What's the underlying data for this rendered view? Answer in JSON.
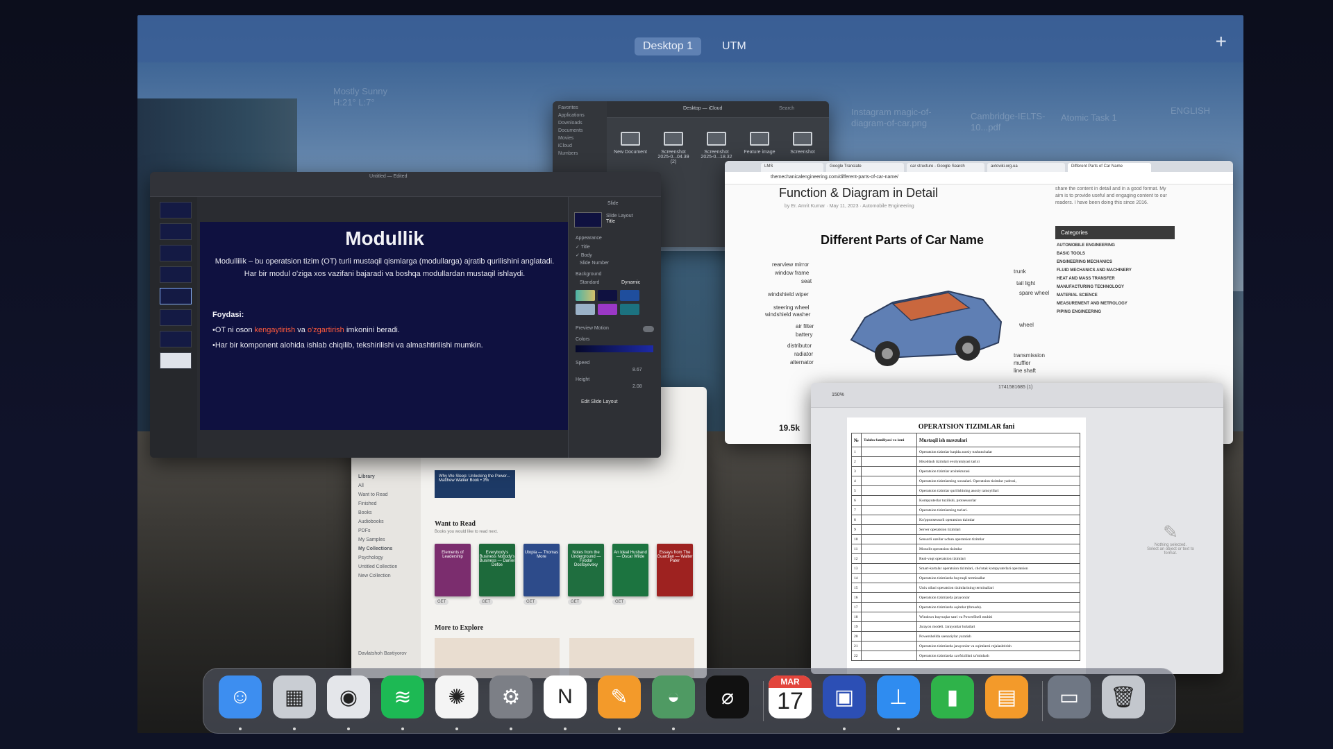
{
  "spaces": {
    "tabs": [
      {
        "label": "Desktop 1"
      },
      {
        "label": "UTM"
      }
    ],
    "add_label": "+"
  },
  "desktop": {
    "weather_city": "Mostly Sunny",
    "weather_temp": "H:21° L:7°",
    "ghost_files": [
      "Instagram magic-of-diagram-of-car.png",
      "Cambridge-IELTS-10...pdf",
      "Atomic Task 1",
      "ENGLISH"
    ]
  },
  "finder": {
    "sidebar": [
      "Favorites",
      "Applications",
      "Downloads",
      "Documents",
      "Movies",
      "iCloud",
      "Numbers"
    ],
    "location": "Desktop — iCloud",
    "search_placeholder": "Search",
    "files": [
      "New Document",
      "Screenshot 2025-0...04.39 (2)",
      "Screenshot 2025-0...18.32",
      "Feature image",
      "Screenshot"
    ]
  },
  "keynote": {
    "window_title": "Untitled — Edited",
    "slide": {
      "title": "Modullik",
      "body": "Modullilik – bu operatsion tizim (OT) turli mustaqil qismlarga (modullarga) ajratib qurilishini anglatadi. Har bir modul o'ziga xos vazifani bajaradi va boshqa modullardan mustaqil ishlaydi.",
      "benefits_heading": "Foydasi:",
      "bullet1_pre": "•OT ni oson ",
      "bullet1_hl1": "kengaytirish",
      "bullet1_mid": " va ",
      "bullet1_hl2": "o'zgartirish",
      "bullet1_post": " imkonini beradi.",
      "bullet2": "•Har bir komponent alohida ishlab chiqilib, tekshirilishi va almashtirilishi mumkin."
    },
    "inspector": {
      "tab": "Slide",
      "layout_label": "Slide Layout",
      "layout_value": "Title",
      "appearance": "Appearance",
      "opt_title": "Title",
      "opt_body": "Body",
      "opt_slide_number": "Slide Number",
      "background": "Background",
      "bg_standard": "Standard",
      "bg_dynamic": "Dynamic",
      "preview_motion": "Preview Motion",
      "colors": "Colors",
      "speed": "Speed",
      "speed_value": "8.67",
      "height": "Height",
      "height_value": "2.08",
      "edit_layout": "Edit Slide Layout"
    },
    "colors": {
      "slide_bg": "#0f1140",
      "highlight": "#ff5a3c"
    }
  },
  "books": {
    "sidebar": [
      "Library",
      "All",
      "Want to Read",
      "Finished",
      "Books",
      "Audiobooks",
      "PDFs",
      "My Samples",
      "My Collections",
      "Psychology",
      "Untitled Collection",
      "New Collection"
    ],
    "user": "Davlatshoh Baxtiyorov",
    "current_book": "Why We Sleep: Unlocking the Power... Matthew Walker Book • 3%",
    "want_to_read": "Want to Read",
    "want_to_read_sub": "Books you would like to read next.",
    "shelf": [
      {
        "title": "Elements of Leadership",
        "color": "#7b2d6e"
      },
      {
        "title": "Everybody's Business Nobody's Business — Daniel Defoe",
        "color": "#1d6a3b"
      },
      {
        "title": "Utopia — Thomas More",
        "color": "#2d4b8a"
      },
      {
        "title": "Notes from the Underground — Fyodor Dostoyevsky",
        "color": "#1f6e3f"
      },
      {
        "title": "An Ideal Husband — Oscar Wilde",
        "color": "#1c7440"
      },
      {
        "title": "Essays from The Guardian — Walter Pater",
        "color": "#9e2220"
      }
    ],
    "get_label": "GET",
    "more_to_explore": "More to Explore"
  },
  "chrome": {
    "tabs": [
      "LMS",
      "Google Translate",
      "car structure - Google Search",
      "avtoviki.org.ua",
      "Different Parts of Car Name"
    ],
    "url": "themechanicalengineering.com/different-parts-of-car-name/",
    "heading": "Function & Diagram in Detail",
    "author": "by Er. Amrit Kumar  ·  May 11, 2023  ·  Automobile Engineering",
    "side_text": "share the content in detail and in a good format. My aim is to provide useful and engaging content to our readers. I have been doing this since 2016.",
    "diagram_title": "Different Parts of Car Name",
    "left_labels": [
      "rearview mirror",
      "window frame",
      "seat",
      "windshield wiper",
      "steering wheel",
      "windshield washer",
      "air filter",
      "battery",
      "distributor",
      "radiator",
      "alternator"
    ],
    "right_labels": [
      "trunk",
      "tail light",
      "spare wheel",
      "wheel",
      "transmission",
      "muffler",
      "line shaft"
    ],
    "views": "19.5k",
    "categories_title": "Categories",
    "categories": [
      "AUTOMOBILE ENGINEERING",
      "BASIC TOOLS",
      "ENGINEERING MECHANICS",
      "FLUID MECHANICS AND MACHINERY",
      "HEAT AND MASS TRANSFER",
      "MANUFACTURING TECHNOLOGY",
      "MATERIAL SCIENCE",
      "MEASUREMENT AND METROLOGY",
      "PIPING ENGINEERING"
    ]
  },
  "pages": {
    "window_title": "1741581685 (1)",
    "zoom": "150%",
    "doc_title": "OPERATSION TIZIMLAR fani",
    "col_num": "№",
    "col_name": "Talaba familiyasi va ismi",
    "col_topic": "Mustaqil ish mavzulari",
    "rows": [
      {
        "n": "1",
        "t": "Operatsion tizimlar haqida asosiy tushunchalar"
      },
      {
        "n": "2",
        "t": "Hisoblash tizimlari evolyutsiyasi tarixi"
      },
      {
        "n": "3",
        "t": "Operatsion tizimlar arxitekturasi"
      },
      {
        "n": "4",
        "t": "Operatsion tizimlarning xossalari. Operatsion tizimlar yadrosi,"
      },
      {
        "n": "5",
        "t": "Operatsion tizimlar qurilishining asosiy tamoyillari"
      },
      {
        "n": "6",
        "t": "Kompyuterlar tuzilishi, protsessorlar"
      },
      {
        "n": "7",
        "t": "Operatsion tizimlarning turlari."
      },
      {
        "n": "8",
        "t": "Ko'pprotsessorli operatsion tizimlar"
      },
      {
        "n": "9",
        "t": "Server operatsion tizimlari"
      },
      {
        "n": "10",
        "t": "Sensorli uzellar uchun operatsion tizimlar"
      },
      {
        "n": "11",
        "t": "Monolit operatsion tizimlar"
      },
      {
        "n": "12",
        "t": "Real-vaqt operatsion tizimlari"
      },
      {
        "n": "13",
        "t": "Smart-kartalar operatsion tizimlari, cho'ntak kompyuterlari operatsion"
      },
      {
        "n": "14",
        "t": "Operatsion tizimlarda buyruqli terminallar"
      },
      {
        "n": "15",
        "t": "Unix oilasi operatsion tizimlarining terminallari"
      },
      {
        "n": "16",
        "t": "Operatsion tizimlarda jarayonlar"
      },
      {
        "n": "17",
        "t": "Operatsion tizimlarda oqimlar (threads)."
      },
      {
        "n": "18",
        "t": "Windows buyruqlar satri va PowerShell muhiti"
      },
      {
        "n": "19",
        "t": "Jarayon modeli. Jarayonlar holatlari"
      },
      {
        "n": "20",
        "t": "Powershellda ssenariylar yaratish"
      },
      {
        "n": "21",
        "t": "Operatsion tizimlarda jarayonlar va oqimlarni rejalashtirish"
      },
      {
        "n": "22",
        "t": "Operatsion tizimlarda xavfsizlikni ta'minlash"
      }
    ],
    "nothing_selected": "Nothing selected.",
    "select_hint": "Select an object or text to format."
  },
  "dock": {
    "calendar_month": "MAR",
    "calendar_day": "17",
    "apps": [
      {
        "name": "Finder",
        "color": "#3d8ef0",
        "glyph": "☺"
      },
      {
        "name": "Launchpad",
        "color": "#c9cdd3",
        "glyph": "▦"
      },
      {
        "name": "Chrome",
        "color": "#e4e6ea",
        "glyph": "◉"
      },
      {
        "name": "Spotify",
        "color": "#1db954",
        "glyph": "≋"
      },
      {
        "name": "ChatGPT",
        "color": "#f4f4f4",
        "glyph": "✺"
      },
      {
        "name": "System Settings",
        "color": "#7c7f86",
        "glyph": "⚙"
      },
      {
        "name": "Notion",
        "color": "#ffffff",
        "glyph": "N"
      },
      {
        "name": "Pages",
        "color": "#f39a2a",
        "glyph": "✎"
      },
      {
        "name": "Maps",
        "color": "#4f9a63",
        "glyph": "◒"
      },
      {
        "name": "Perplexity",
        "color": "#111111",
        "glyph": "⌀"
      },
      {
        "name": "Calendar",
        "color": "#ffffff",
        "glyph": ""
      },
      {
        "name": "Screens",
        "color": "#2c4fb5",
        "glyph": "▣"
      },
      {
        "name": "Keynote",
        "color": "#2f8cf0",
        "glyph": "⊥"
      },
      {
        "name": "Numbers",
        "color": "#2fb34a",
        "glyph": "▮"
      },
      {
        "name": "Books",
        "color": "#f39a2a",
        "glyph": "▤"
      },
      {
        "name": "Downloads",
        "color": "#6f7784",
        "glyph": "▭"
      },
      {
        "name": "Trash",
        "color": "#c3c7cd",
        "glyph": "🗑"
      }
    ]
  }
}
